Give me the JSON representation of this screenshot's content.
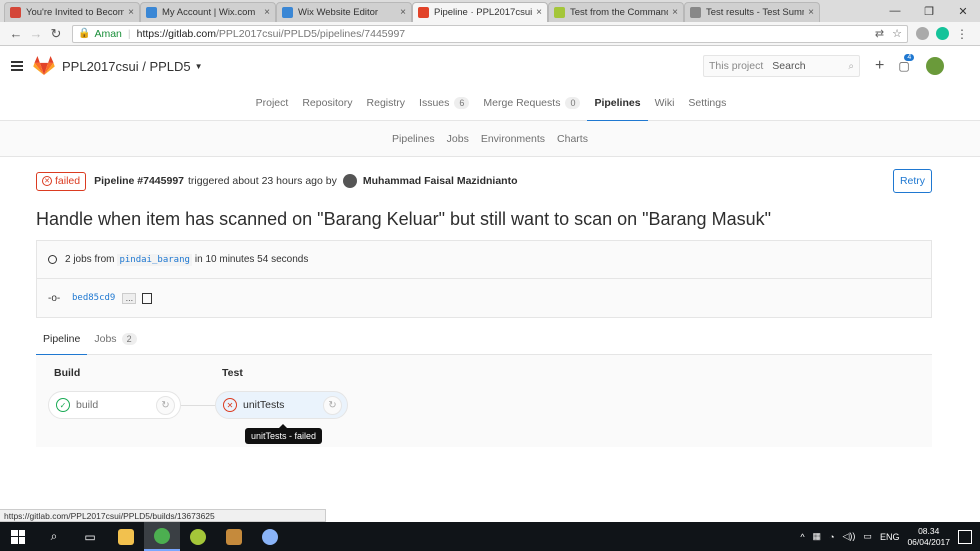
{
  "browser": {
    "tabs": [
      {
        "label": "You're Invited to Becom",
        "icon": "gmail-icon",
        "color": "#d44638"
      },
      {
        "label": "My Account | Wix.com",
        "icon": "wix-icon",
        "color": "#3a87d5"
      },
      {
        "label": "Wix Website Editor",
        "icon": "wix-icon",
        "color": "#3a87d5"
      },
      {
        "label": "Pipeline · PPL2017csui /",
        "icon": "gitlab-icon",
        "color": "#e24329",
        "active": true
      },
      {
        "label": "Test from the Command",
        "icon": "android-icon",
        "color": "#a4c639"
      },
      {
        "label": "Test results - Test Summ",
        "icon": "doc-icon",
        "color": "#888888"
      }
    ],
    "address": {
      "secure_label": "Aman",
      "url_host": "https://gitlab.com",
      "url_path": "/PPL2017csui/PPLD5/pipelines/7445997"
    },
    "status_url": "https://gitlab.com/PPL2017csui/PPLD5/builds/13673625"
  },
  "header": {
    "project": "PPL2017csui / PPLD5",
    "search_scope": "This project",
    "search_placeholder": "Search",
    "todo_count": "4"
  },
  "nav": {
    "items": [
      {
        "label": "Project"
      },
      {
        "label": "Repository"
      },
      {
        "label": "Registry"
      },
      {
        "label": "Issues",
        "badge": "6"
      },
      {
        "label": "Merge Requests",
        "badge": "0"
      },
      {
        "label": "Pipelines",
        "active": true
      },
      {
        "label": "Wiki"
      },
      {
        "label": "Settings"
      }
    ],
    "subitems": [
      "Pipelines",
      "Jobs",
      "Environments",
      "Charts"
    ]
  },
  "pipeline": {
    "status": "failed",
    "id_label": "Pipeline #7445997",
    "triggered_text": "triggered about 23 hours ago by",
    "user": "Muhammad Faisal Mazidnianto",
    "retry_label": "Retry",
    "title": "Handle when item has scanned on \"Barang Keluar\" but still want to scan on \"Barang Masuk\"",
    "jobs_prefix": "2 jobs from",
    "branch": "pindai_barang",
    "duration": "in 10 minutes 54 seconds",
    "sha": "bed85cd9",
    "ellipsis": "...",
    "tabs": [
      {
        "label": "Pipeline",
        "active": true
      },
      {
        "label": "Jobs",
        "badge": "2"
      }
    ],
    "stages": [
      {
        "title": "Build",
        "job": "build",
        "status": "success"
      },
      {
        "title": "Test",
        "job": "unitTests",
        "status": "failed"
      }
    ],
    "tooltip": "unitTests - failed"
  },
  "taskbar": {
    "lang": "ENG",
    "time": "08.34",
    "date": "06/04/2017"
  },
  "colors": {
    "accent": "#1f78d1",
    "failed": "#db3b21",
    "success": "#1aaa55"
  }
}
